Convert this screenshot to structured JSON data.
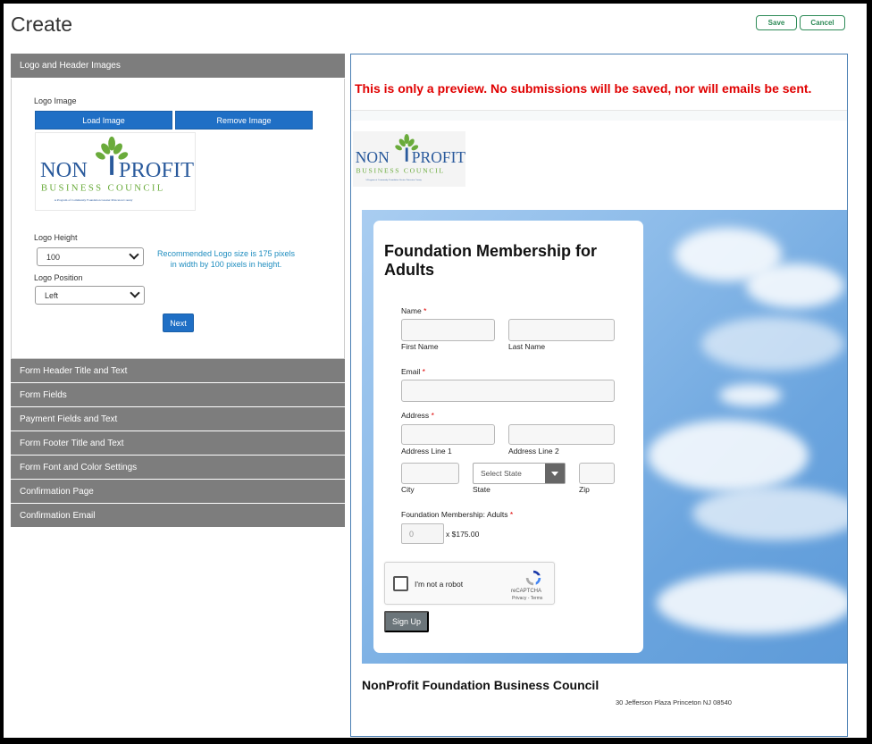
{
  "page": {
    "title": "Create",
    "save_label": "Save",
    "cancel_label": "Cancel"
  },
  "colors": {
    "accent_green": "#2e8b57",
    "primary_blue": "#1f6fc5",
    "accordion_gray": "#7d7d7d",
    "warning_red": "#e00000"
  },
  "left_panel": {
    "open_section": {
      "title": "Logo and Header Images",
      "logo_image_label": "Logo Image",
      "load_image_label": "Load Image",
      "remove_image_label": "Remove Image",
      "logo_height_label": "Logo Height",
      "logo_height_value": "100",
      "recommendation": "Recommended Logo size is 175 pixels in width by 100 pixels in height.",
      "logo_position_label": "Logo Position",
      "logo_position_value": "Left",
      "next_label": "Next"
    },
    "sections": [
      {
        "title": "Form Header Title and Text"
      },
      {
        "title": "Form Fields"
      },
      {
        "title": "Payment Fields and Text"
      },
      {
        "title": "Form Footer Title and Text"
      },
      {
        "title": "Form Font and Color Settings"
      },
      {
        "title": "Confirmation Page"
      },
      {
        "title": "Confirmation Email"
      }
    ]
  },
  "logo": {
    "line1": "NON",
    "line2": "PROFIT",
    "line3": "BUSINESS COUNCIL",
    "tagline": "A Program of Community Foundation Greater Princeton County"
  },
  "preview": {
    "warning": "This is only a preview. No submissions will be saved, nor will emails be sent.",
    "form_title": "Foundation Membership for Adults",
    "name_label": "Name",
    "first_name_label": "First Name",
    "last_name_label": "Last Name",
    "email_label": "Email",
    "address_label": "Address",
    "address1_label": "Address Line 1",
    "address2_label": "Address Line 2",
    "city_label": "City",
    "state_label": "State",
    "state_placeholder": "Select State",
    "zip_label": "Zip",
    "membership_label": "Foundation Membership: Adults",
    "quantity_value": "0",
    "price_text": "x $175.00",
    "captcha_text": "I'm not a robot",
    "captcha_brand": "reCAPTCHA",
    "captcha_links": "Privacy - Terms",
    "required_mark": "*",
    "signup_label": "Sign Up",
    "footer_title": "NonProfit Foundation Business Council",
    "footer_address": "30 Jefferson Plaza Princeton NJ 08540"
  }
}
